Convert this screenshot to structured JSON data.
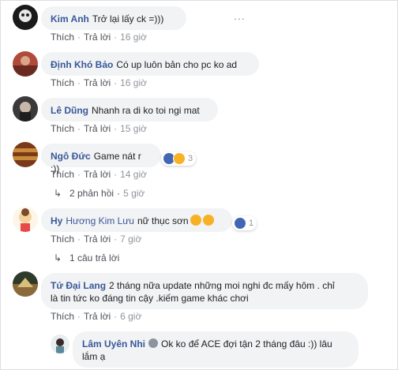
{
  "comments": [
    {
      "name": "Kim Anh",
      "text": "Trở lại lấy ck =)))",
      "like": "Thích",
      "reply": "Trả lời",
      "time": "16 giờ"
    },
    {
      "name": "Định Khó Bảo",
      "text": "Có up luôn bản cho pc ko ad",
      "like": "Thích",
      "reply": "Trả lời",
      "time": "16 giờ"
    },
    {
      "name": "Lê Dũng",
      "text": "Nhanh ra di ko toi ngi mat",
      "like": "Thích",
      "reply": "Trả lời",
      "time": "15 giờ"
    },
    {
      "name": "Ngô Đức",
      "text": "Game nát r :))",
      "like": "Thích",
      "reply": "Trả lời",
      "time": "14 giờ",
      "reaction_count": "3",
      "replies_label": "2 phản hồi",
      "replies_time": "5 giờ"
    },
    {
      "name": "Hy Hương Kim Lưu",
      "name_bold": "Hy",
      "name_rest": "Hương Kim Lưu",
      "text": "nữ thục sơn",
      "like": "Thích",
      "reply": "Trả lời",
      "time": "7 giờ",
      "reaction_count": "1",
      "replies_label": "1 câu trả lời"
    },
    {
      "name": "Tứ Đại Lang",
      "text_line1": "2 tháng nữa update những moi nghi đc mấy hôm . chỉ",
      "text_line2": "là tin tức ko đáng tin cậy .kiếm game khác chơi",
      "like": "Thích",
      "reply": "Trả lời",
      "time": "6 giờ"
    }
  ],
  "nested_reply": {
    "name": "Lâm Uyên Nhi",
    "text_line1": "Ok ko để ACE đợi tận 2 tháng đâu :)) lâu",
    "text_line2": "lắm ạ"
  },
  "separator": "·",
  "more_icon": "...",
  "reply_arrow_icon": "↳"
}
